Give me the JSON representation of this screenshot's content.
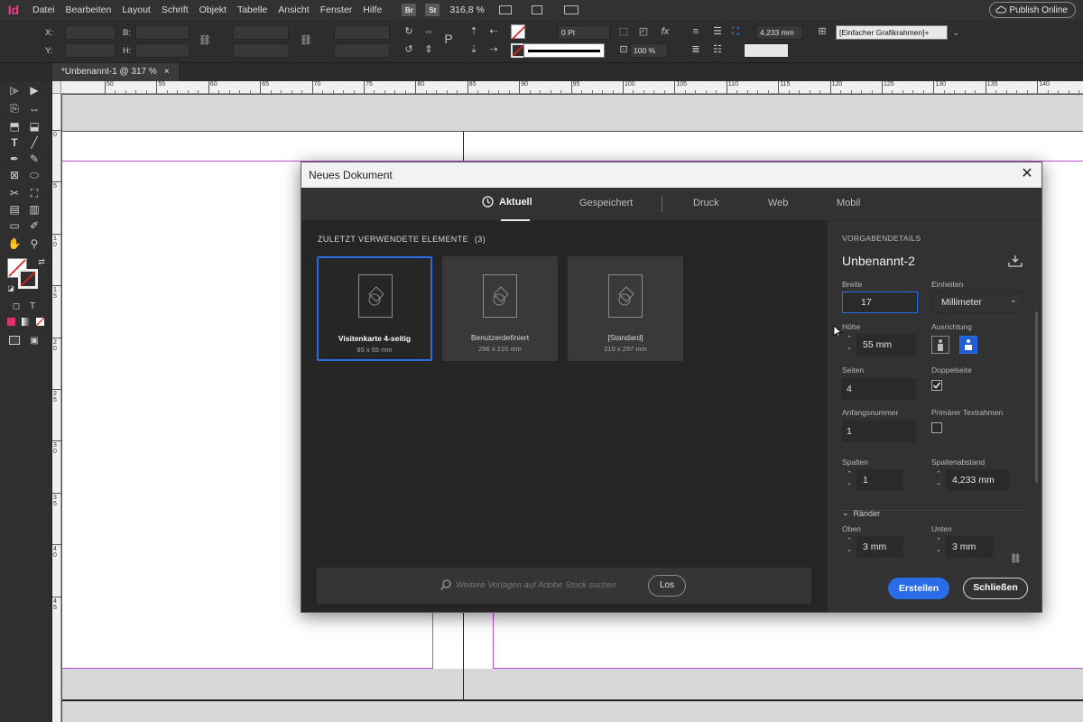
{
  "app": {
    "logo": "Id",
    "menu": [
      "Datei",
      "Bearbeiten",
      "Layout",
      "Schrift",
      "Objekt",
      "Tabelle",
      "Ansicht",
      "Fenster",
      "Hilfe"
    ],
    "bridge_badge": "Br",
    "stock_badge": "St",
    "zoom": "316,8 %",
    "publish_label": "Publish Online"
  },
  "control_panel": {
    "x_label": "X:",
    "y_label": "Y:",
    "w_label": "B:",
    "h_label": "H:",
    "stroke_weight": "0 Pt",
    "opacity": "100 %",
    "offset": "4,233 mm",
    "object_style": "[Einfacher Grafikrahmen]+"
  },
  "document_tab": {
    "title": "*Unbenannt-1 @ 317 %",
    "close": "×"
  },
  "ruler": {
    "h_ticks": [
      "50",
      "55",
      "60",
      "65",
      "70",
      "75",
      "80",
      "85",
      "90",
      "95",
      "100",
      "105",
      "110",
      "115",
      "120",
      "125",
      "130",
      "135",
      "140"
    ],
    "v_ticks": [
      "0",
      "5",
      "1 0",
      "1 5",
      "2 0",
      "2 5",
      "3 0",
      "3 5",
      "4 0",
      "4 5"
    ]
  },
  "dialog": {
    "title": "Neues Dokument",
    "close": "✕",
    "tabs": [
      "Aktuell",
      "Gespeichert",
      "Druck",
      "Web",
      "Mobil"
    ],
    "active_tab": "Aktuell",
    "recent_heading": "ZULETZT VERWENDETE ELEMENTE",
    "recent_count": "(3)",
    "presets": [
      {
        "name": "Visitenkarte 4-seitig",
        "size": "85 x 55 mm",
        "selected": true
      },
      {
        "name": "Benutzerdefiniert",
        "size": "296 x 210 mm",
        "selected": false
      },
      {
        "name": "[Standard]",
        "size": "210 x 297 mm",
        "selected": false
      }
    ],
    "stock_search_placeholder": "Weitere Vorlagen auf Adobe Stock suchen",
    "stock_go_label": "Los",
    "details": {
      "heading": "VORGABENDETAILS",
      "preset_name": "Unbenannt-2",
      "width_label": "Breite",
      "width_value": "17",
      "units_label": "Einheiten",
      "units_value": "Millimeter",
      "height_label": "Höhe",
      "height_value": "55 mm",
      "orientation_label": "Ausrichtung",
      "orientation_selected": "landscape",
      "pages_label": "Seiten",
      "pages_value": "4",
      "facing_label": "Doppelseite",
      "facing_checked": true,
      "start_label": "Anfangsnummer",
      "start_value": "1",
      "primary_frame_label": "Primärer Textrahmen",
      "primary_frame_checked": false,
      "columns_label": "Spalten",
      "columns_value": "1",
      "gutter_label": "Spaltenabstand",
      "gutter_value": "4,233 mm",
      "margins_label": "Ränder",
      "top_label": "Oben",
      "top_value": "3 mm",
      "bottom_label": "Unten",
      "bottom_value": "3 mm"
    },
    "create_label": "Erstellen",
    "close_label": "Schließen"
  },
  "colors": {
    "accent": "#2a6ce8",
    "app_bar": "#323232",
    "dialog_bg": "#252525",
    "margin_guide": "#b84fd1",
    "indesign_pink": "#ff3a8c"
  }
}
